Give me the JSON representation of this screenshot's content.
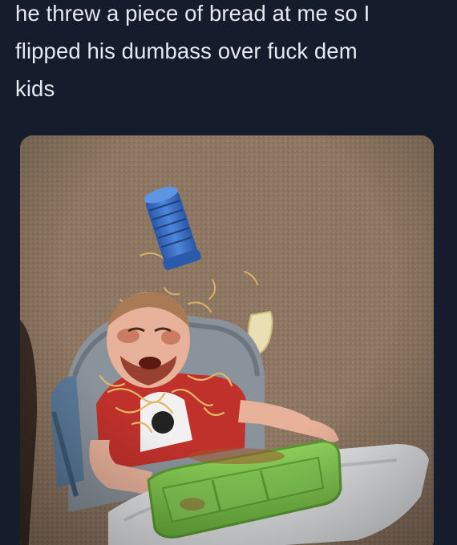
{
  "tweet": {
    "text_lines": [
      "he threw a piece of bread at me so I",
      "flipped his dumbass over fuck dem",
      "kids"
    ]
  },
  "media": {
    "type": "photo",
    "colors": {
      "page_background": "#151c2c",
      "text": "#e6e9ef",
      "carpet": "#8d7662",
      "sippy_cup": "#3a6fc4",
      "high_chair": "#8a929c",
      "shirt": "#c0312b",
      "tray": "#7ec24a",
      "table": "#e4e6e8",
      "bread": "#e9dfb2"
    }
  }
}
